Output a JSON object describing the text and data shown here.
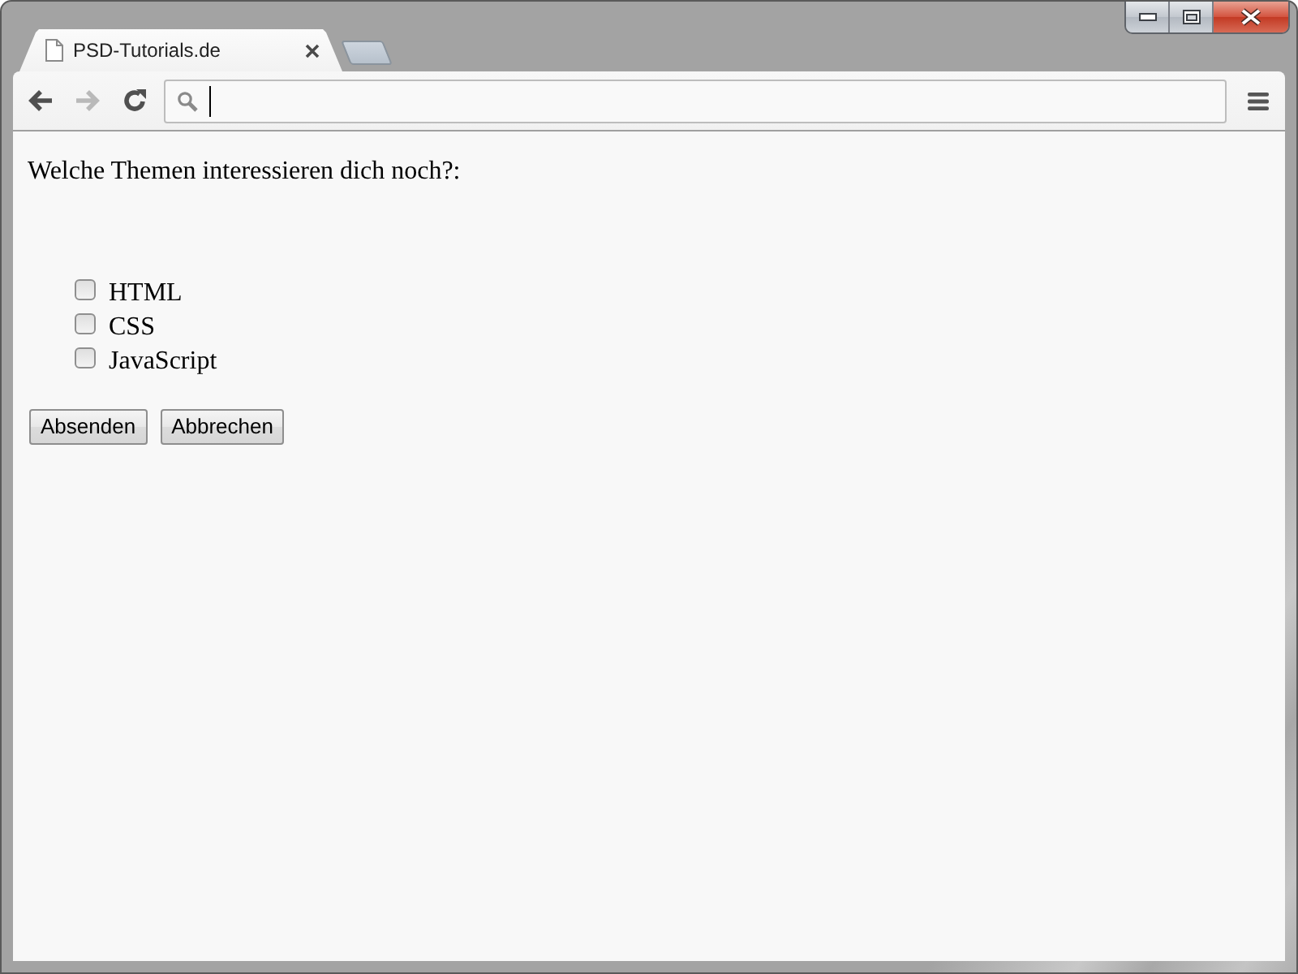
{
  "tabs": [
    {
      "label": "PSD-Tutorials.de",
      "selected": true
    }
  ],
  "navigation": {
    "back_disabled": false,
    "forward_disabled": true
  },
  "address_bar": {
    "focused": true
  },
  "page": {
    "question": "Welche Themen interessieren dich noch?:",
    "options": [
      {
        "label": "HTML",
        "checked": false
      },
      {
        "label": "CSS",
        "checked": false
      },
      {
        "label": "JavaScript",
        "checked": false
      }
    ],
    "buttons": [
      "Absenden",
      "Abbrechen"
    ]
  }
}
